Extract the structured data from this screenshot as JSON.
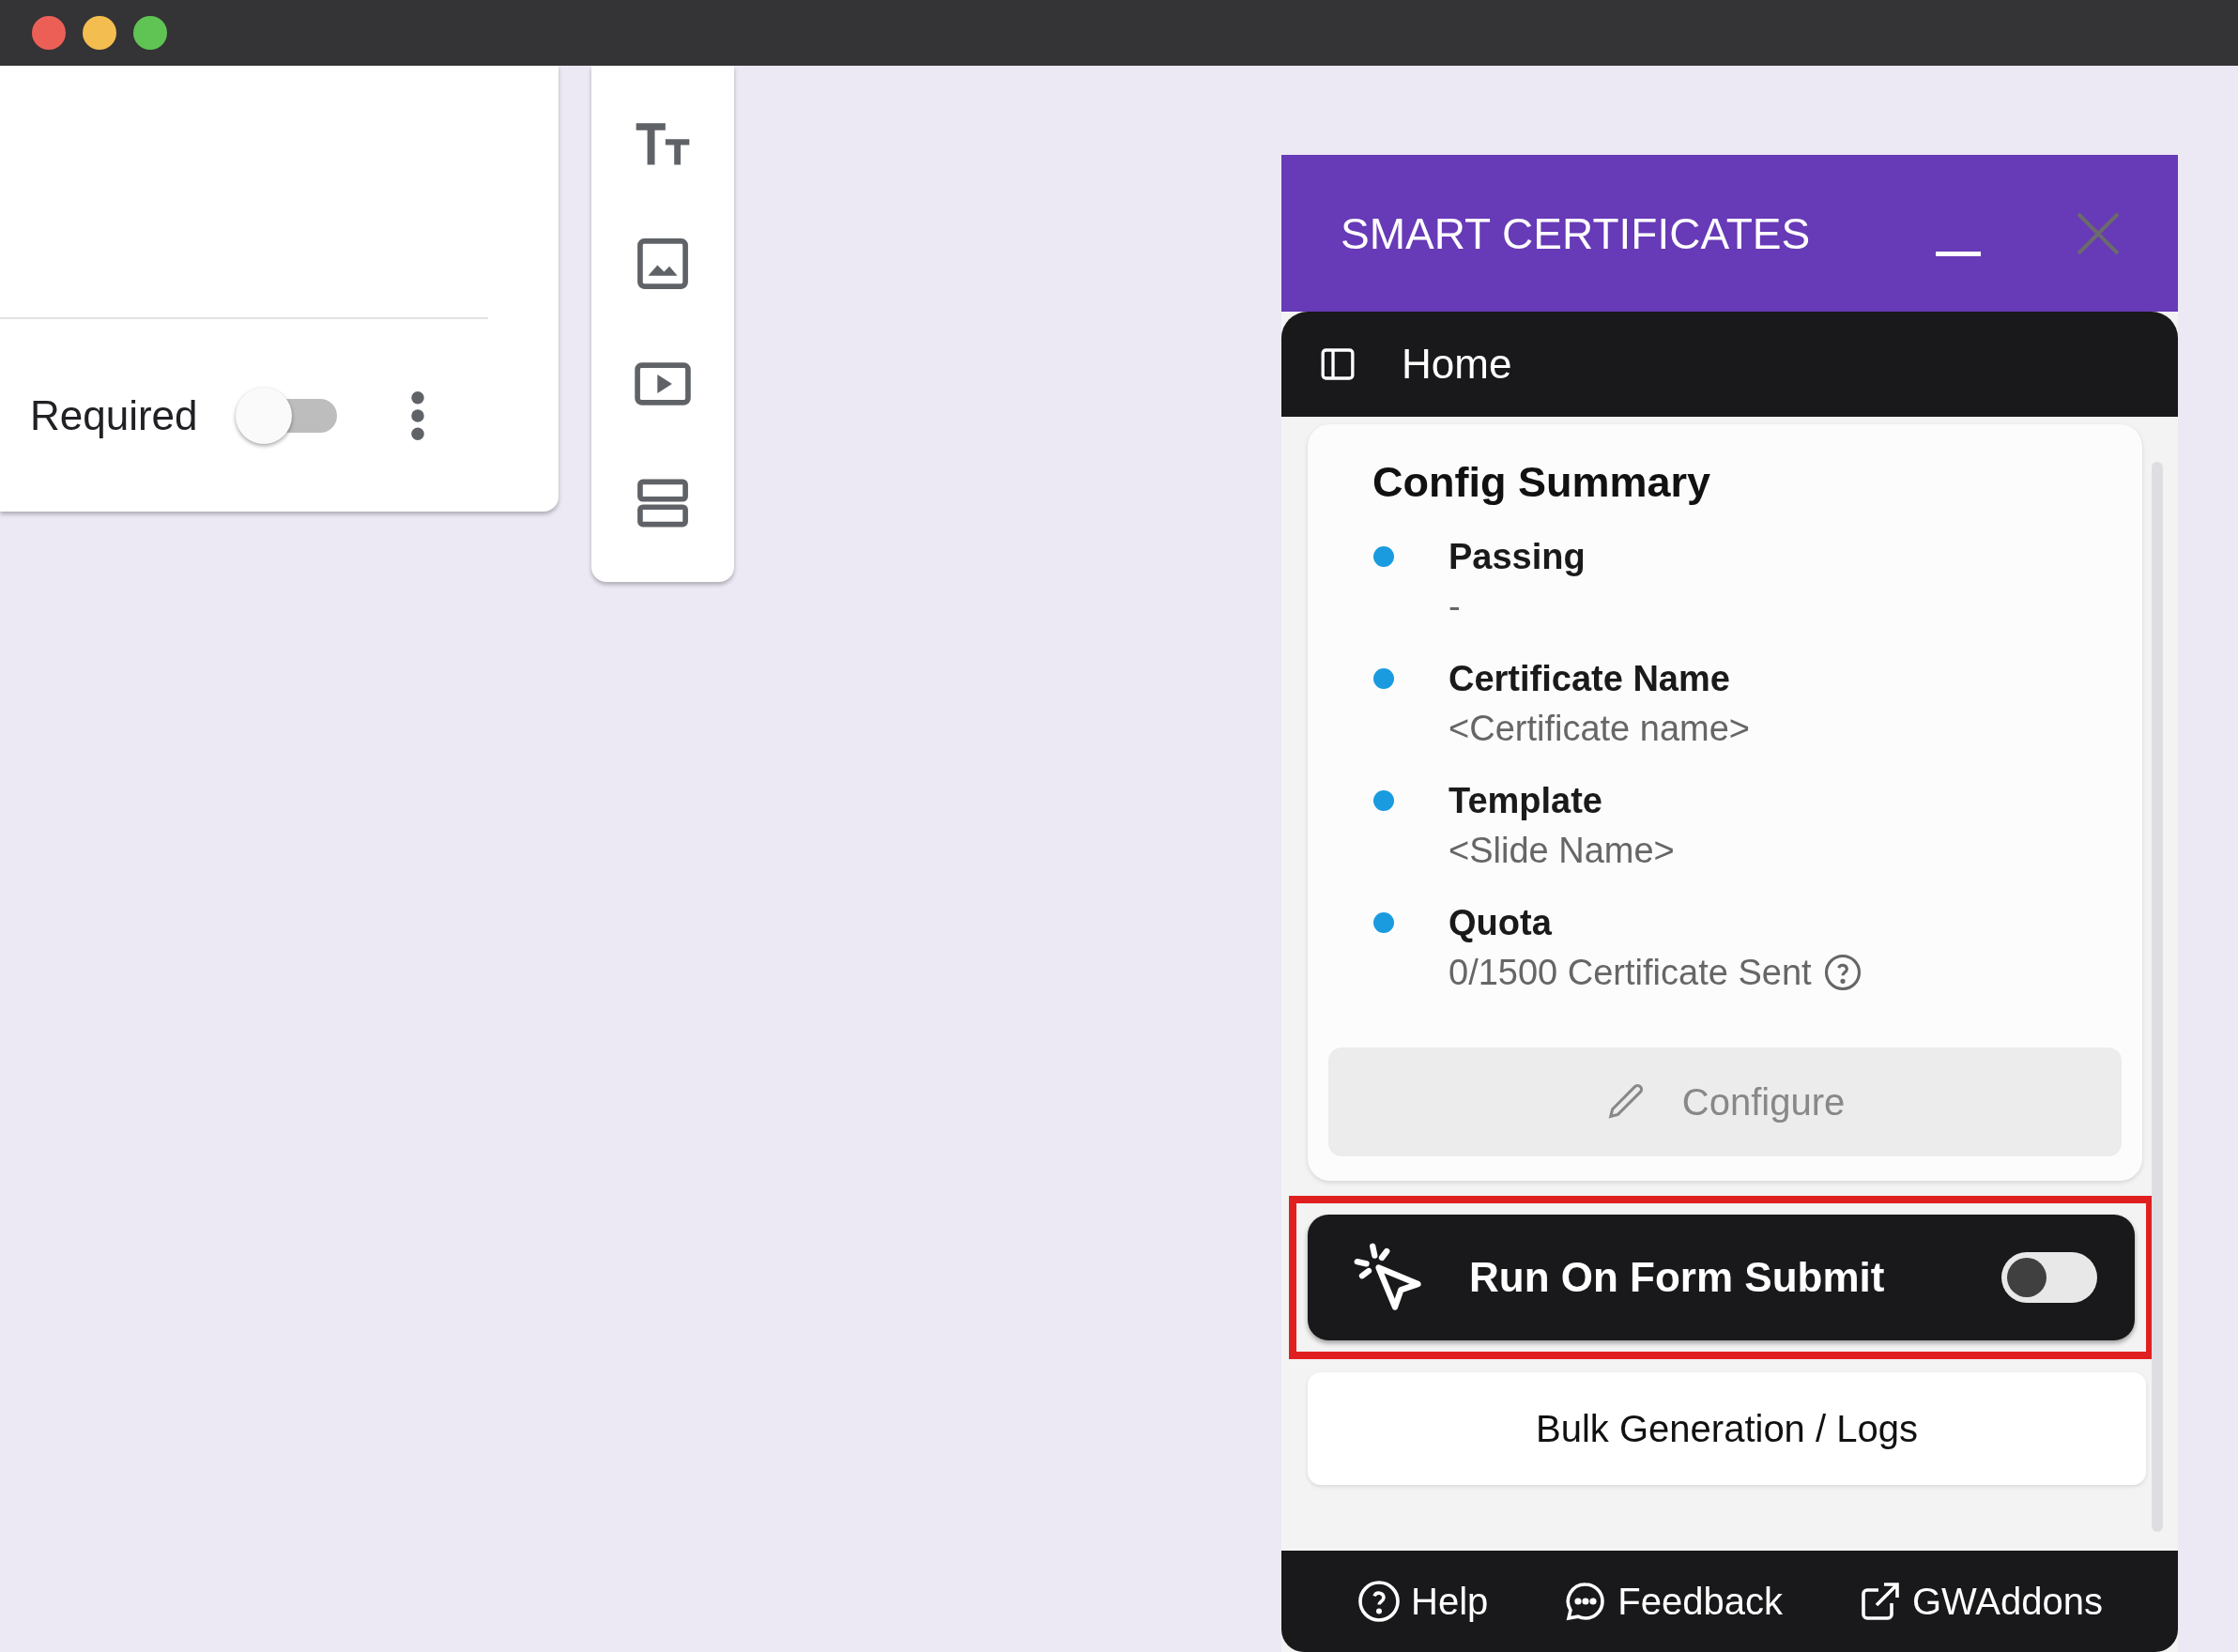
{
  "form_card": {
    "required_label": "Required",
    "required_on": false
  },
  "sidebar": {
    "title": "SMART CERTIFICATES",
    "nav_title": "Home",
    "summary": {
      "title": "Config Summary",
      "items": [
        {
          "label": "Passing",
          "value": "-",
          "kind": "plain"
        },
        {
          "label": "Certificate Name",
          "value": "<Certificate name>",
          "kind": "plain"
        },
        {
          "label": "Template",
          "value": "<Slide Name>",
          "kind": "plain"
        },
        {
          "label": "Quota",
          "value": "0/1500 Certificate Sent",
          "kind": "help"
        }
      ],
      "configure_button": {
        "label": "Configure",
        "disabled": true
      }
    },
    "run_on_submit": {
      "label": "Run On Form Submit",
      "on": false,
      "highlighted": true
    },
    "bulk_button": {
      "label": "Bulk Generation / Logs"
    },
    "footer_links": [
      {
        "label": "Help",
        "kind": "help"
      },
      {
        "label": "Feedback",
        "kind": "feedback"
      },
      {
        "label": "GWAddons",
        "kind": "external"
      }
    ]
  }
}
